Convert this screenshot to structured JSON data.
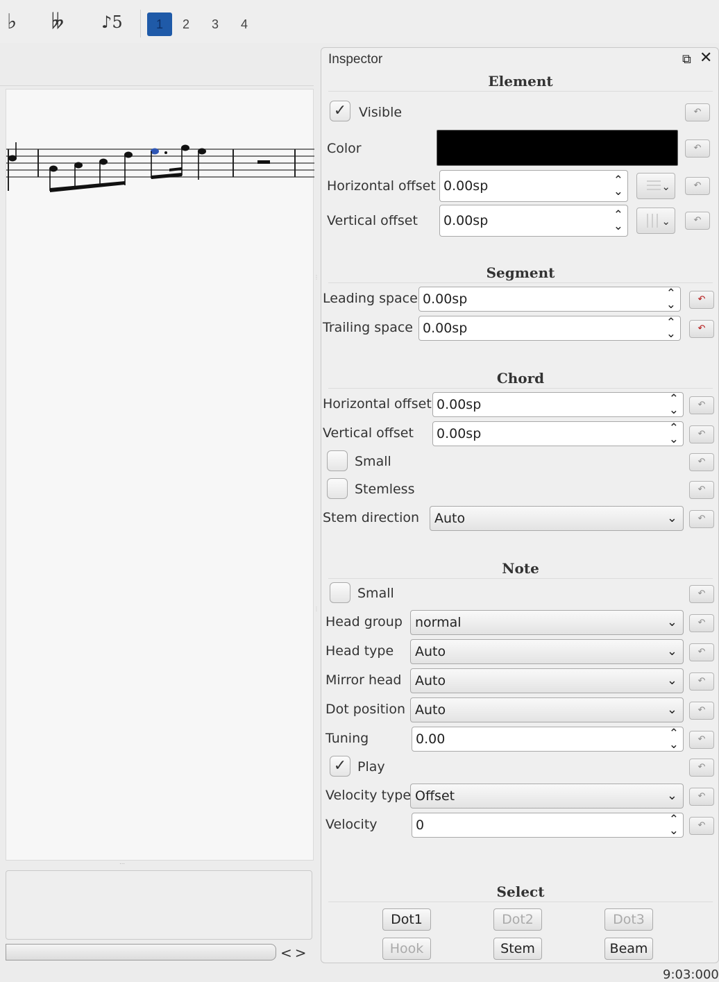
{
  "toolbar": {
    "flat_glyph": "♭",
    "double_flat_glyph": "𝄫",
    "tuplet_glyph": "♪5",
    "voices": [
      "1",
      "2",
      "3",
      "4"
    ],
    "active_voice": "1"
  },
  "inspector": {
    "title": "Inspector",
    "float_icon": "float-icon",
    "close_icon": "close-icon",
    "element": {
      "section_title": "Element",
      "visible_label": "Visible",
      "visible_checked": true,
      "color_label": "Color",
      "color_value": "#000000",
      "h_offset_label": "Horizontal offset",
      "h_offset_value": "0.00sp",
      "v_offset_label": "Vertical offset",
      "v_offset_value": "0.00sp"
    },
    "segment": {
      "section_title": "Segment",
      "leading_label": "Leading space",
      "leading_value": "0.00sp",
      "trailing_label": "Trailing space",
      "trailing_value": "0.00sp"
    },
    "chord": {
      "section_title": "Chord",
      "h_offset_label": "Horizontal offset",
      "h_offset_value": "0.00sp",
      "v_offset_label": "Vertical offset",
      "v_offset_value": "0.00sp",
      "small_label": "Small",
      "stemless_label": "Stemless",
      "stem_dir_label": "Stem direction",
      "stem_dir_value": "Auto"
    },
    "note": {
      "section_title": "Note",
      "small_label": "Small",
      "head_group_label": "Head group",
      "head_group_value": "normal",
      "head_type_label": "Head type",
      "head_type_value": "Auto",
      "mirror_head_label": "Mirror head",
      "mirror_head_value": "Auto",
      "dot_position_label": "Dot position",
      "dot_position_value": "Auto",
      "tuning_label": "Tuning",
      "tuning_value": "0.00",
      "play_label": "Play",
      "play_checked": true,
      "velocity_type_label": "Velocity type",
      "velocity_type_value": "Offset",
      "velocity_label": "Velocity",
      "velocity_value": "0"
    },
    "select": {
      "section_title": "Select",
      "dot1": "Dot1",
      "dot2": "Dot2",
      "dot3": "Dot3",
      "hook": "Hook",
      "stem": "Stem",
      "beam": "Beam"
    }
  },
  "status": {
    "time": "9:03:000"
  },
  "colors": {
    "selection_blue": "#1f5aa8",
    "reset_red": "#b31313"
  }
}
